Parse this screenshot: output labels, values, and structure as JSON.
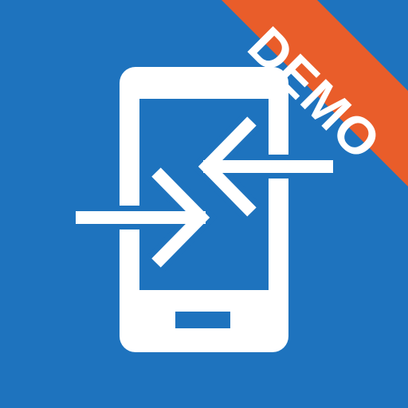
{
  "app_icon": {
    "badge_text": "DEMO",
    "icons": {
      "phone": "smartphone-icon",
      "arrow_in": "arrow-right-icon",
      "arrow_out": "arrow-left-icon"
    },
    "colors": {
      "background": "#1e73be",
      "badge": "#e95d2a",
      "foreground": "#ffffff"
    }
  }
}
